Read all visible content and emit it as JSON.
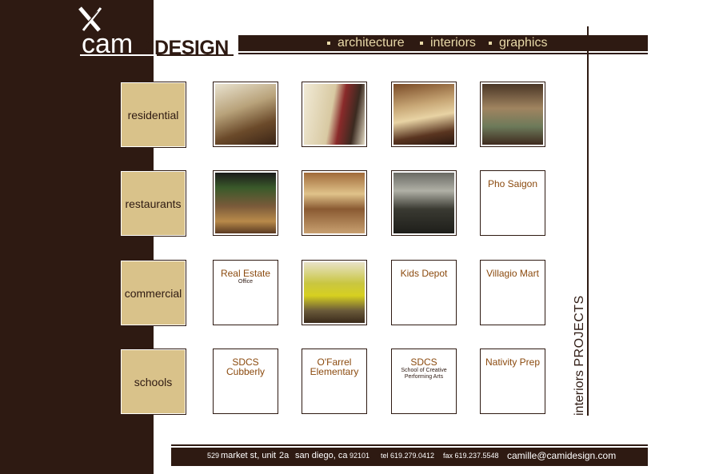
{
  "logo": {
    "cam": "cam",
    "slash": "/",
    "design": "DESIGN"
  },
  "nav": {
    "items": [
      "architecture",
      "interiors",
      "graphics"
    ]
  },
  "side_label": {
    "prefix": "interiors",
    "main": "PROJECTS"
  },
  "categories": [
    "residential",
    "restaurants",
    "commercial",
    "schools"
  ],
  "tiles": {
    "restaurants_4": {
      "title": "Pho Saigon"
    },
    "commercial_1": {
      "title": "Real Estate",
      "sub": "Office"
    },
    "commercial_3": {
      "title": "Kids Depot"
    },
    "commercial_4": {
      "title": "Villagio Mart"
    },
    "schools_1": {
      "title": "SDCS",
      "title2": "Cubberly"
    },
    "schools_2": {
      "title": "O'Farrel",
      "title2": "Elementary"
    },
    "schools_3": {
      "title": "SDCS",
      "sub": "School of Creative",
      "sub2": "Performing Arts"
    },
    "schools_4": {
      "title": "Nativity Prep"
    }
  },
  "footer": {
    "addr_num": "529",
    "addr_street": "market st, unit",
    "addr_unit": "2a",
    "city": "san diego, ca",
    "zip": "92101",
    "tel": "tel 619.279.0412",
    "fax": "fax 619.237.5548",
    "email": "camille@camidesign.com"
  },
  "colors": {
    "brown": "#2e1a12",
    "tan": "#d9c28a",
    "gold_text": "#e8d9a8",
    "link": "#8b4a0e"
  }
}
